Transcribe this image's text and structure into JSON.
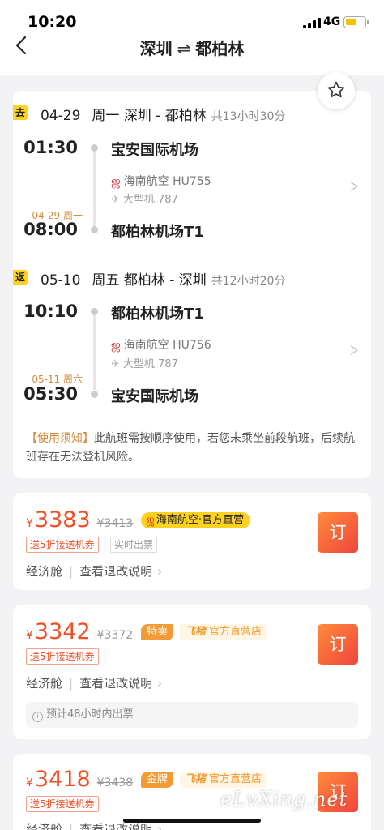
{
  "status_bar": {
    "time": "10:20",
    "network": "4G"
  },
  "header": {
    "from": "深圳",
    "swap_symbol": "⇌",
    "to": "都柏林"
  },
  "trip": {
    "outbound": {
      "tag": "去",
      "date": "04-29",
      "weekday": "周一",
      "route": "深圳 - 都柏林",
      "duration": "共13小时30分",
      "dep_time": "01:30",
      "dep_airport": "宝安国际机场",
      "airline": "海南航空 HU755",
      "aircraft": "大型机 787",
      "arr_date_note": "04-29 周一",
      "arr_time": "08:00",
      "arr_airport": "都柏林机场T1"
    },
    "return": {
      "tag": "返",
      "date": "05-10",
      "weekday": "周五",
      "route": "都柏林 - 深圳",
      "duration": "共12小时20分",
      "dep_time": "10:10",
      "dep_airport": "都柏林机场T1",
      "airline": "海南航空 HU756",
      "aircraft": "大型机 787",
      "arr_date_note": "05-11 周六",
      "arr_time": "05:30",
      "arr_airport": "宝安国际机场"
    },
    "notice_title": "【使用须知】",
    "notice_text": "此航班需按顺序使用，若您未乘坐前段航班，后续航班存在无法登机风险。"
  },
  "offers": [
    {
      "currency": "¥",
      "price": "3383",
      "old_price": "¥3413",
      "seller": "海南航空·官方直营",
      "chips": [
        "送5折接送机券",
        "实时出票"
      ],
      "cabin": "经济舱",
      "refund": "查看退改说明",
      "book": "订"
    },
    {
      "currency": "¥",
      "price": "3342",
      "old_price": "¥3372",
      "label": "特卖",
      "shop_brand": "飞猪",
      "shop": "官方直营店",
      "chips": [
        "送5折接送机券"
      ],
      "cabin": "经济舱",
      "refund": "查看退改说明",
      "book": "订",
      "note": "预计48小时内出票"
    },
    {
      "currency": "¥",
      "price": "3418",
      "old_price": "¥3438",
      "label": "金牌",
      "shop_brand": "飞猪",
      "shop": "官方直营店",
      "chips": [
        "送5折接送机券"
      ],
      "cabin": "经济舱",
      "refund": "查看退改说明",
      "book": "订"
    }
  ],
  "watermark": "eLvXing.net",
  "icons": [
    "back-arrow-icon",
    "star-outline-icon",
    "hainan-airlines-logo-icon",
    "plane-icon",
    "chevron-right-icon",
    "info-icon",
    "signal-icon",
    "battery-icon"
  ],
  "colors": {
    "accent_price": "#f04e23",
    "tag_yellow": "#ffd21f",
    "book_button": "#f0453b",
    "date_note": "#d48a3c"
  }
}
